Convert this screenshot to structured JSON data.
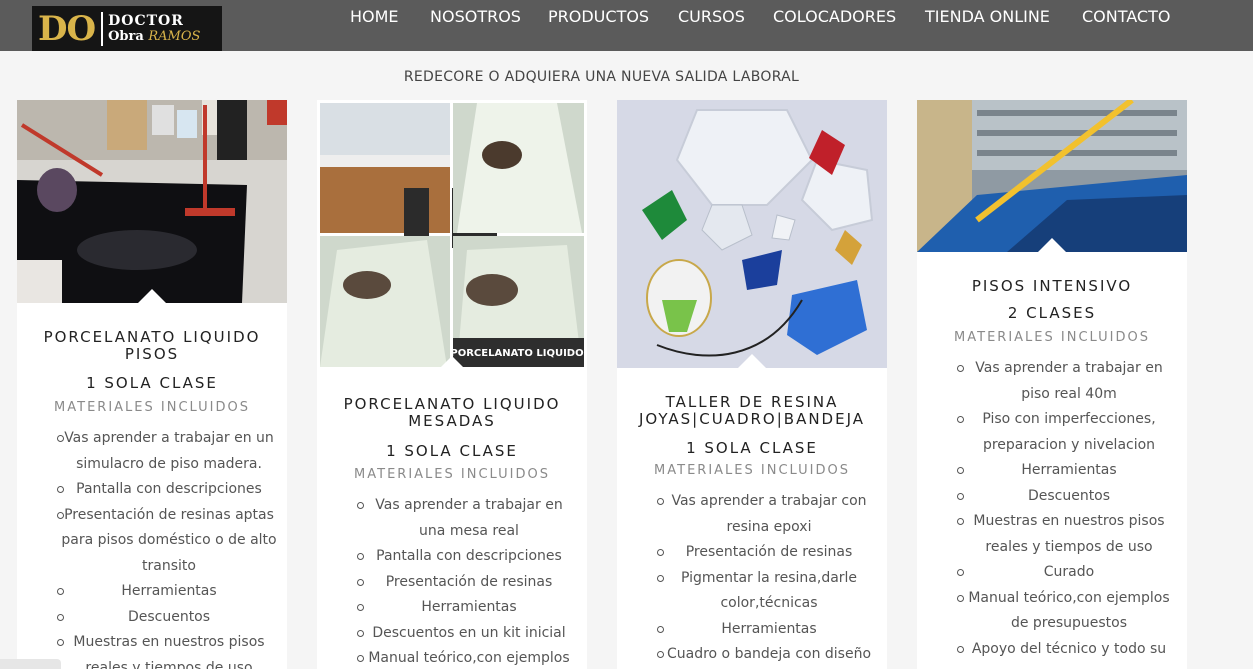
{
  "logo": {
    "mark": "DO",
    "line1": "DOCTOR",
    "line2_a": "Obra",
    "line2_b": "RAMOS"
  },
  "nav": {
    "items": [
      {
        "label": "HOME"
      },
      {
        "label": "NOSOTROS"
      },
      {
        "label": "PRODUCTOS"
      },
      {
        "label": "CURSOS"
      },
      {
        "label": "COLOCADORES"
      },
      {
        "label": "TIENDA ONLINE"
      },
      {
        "label": "CONTACTO"
      }
    ]
  },
  "tagline": "REDECORE O ADQUIERA UNA NUEVA SALIDA LABORAL",
  "colors": {
    "nav_bg": "#5b5b5b",
    "logo_gold": "#d9b44a",
    "page_bg": "#f5f5f5"
  },
  "cards": [
    {
      "title_l1": "PORCELANATO LIQUIDO",
      "title_l2": "PISOS",
      "sessions": "1 SOLA CLASE",
      "materials": "MATERIALES INCLUIDOS",
      "items": [
        "Vas aprender a trabajar en un simulacro de piso madera.",
        "Pantalla con descripciones",
        "Presentación de resinas aptas para pisos doméstico o de alto transito",
        "Herramientas",
        "Descuentos",
        "Muestras en nuestros pisos reales y tiempos de uso"
      ]
    },
    {
      "title_l1": "PORCELANATO LIQUIDO",
      "title_l2": "MESADAS",
      "sessions": "1 SOLA CLASE",
      "materials": "MATERIALES INCLUIDOS",
      "photo_caption": "PORCELANATO LIQUIDO",
      "items": [
        "Vas aprender a trabajar en una mesa real",
        "Pantalla con descripciones",
        "Presentación de resinas",
        "Herramientas",
        "Descuentos en un kit inicial",
        "Manual teórico,con ejemplos"
      ]
    },
    {
      "title_l1": "TALLER DE RESINA",
      "title_l2": "JOYAS|CUADRO|BANDEJA",
      "sessions": "1 SOLA CLASE",
      "materials": "MATERIALES INCLUIDOS",
      "items": [
        "Vas aprender a trabajar con resina epoxi",
        "Presentación de resinas",
        "Pigmentar la resina,darle color,técnicas",
        "Herramientas",
        "Cuadro o bandeja con diseño"
      ]
    },
    {
      "title_l1": "PISOS INTENSIVO",
      "title_l2": "2 CLASES",
      "materials": "MATERIALES INCLUIDOS",
      "items": [
        "Vas aprender a trabajar en piso real 40m",
        "Piso con imperfecciones, preparacion y nivelacion",
        "Herramientas",
        "Descuentos",
        "Muestras en nuestros pisos reales y tiempos de uso",
        "Curado",
        "Manual teórico,con ejemplos de presupuestos",
        "Apoyo del técnico y todo su"
      ]
    }
  ]
}
